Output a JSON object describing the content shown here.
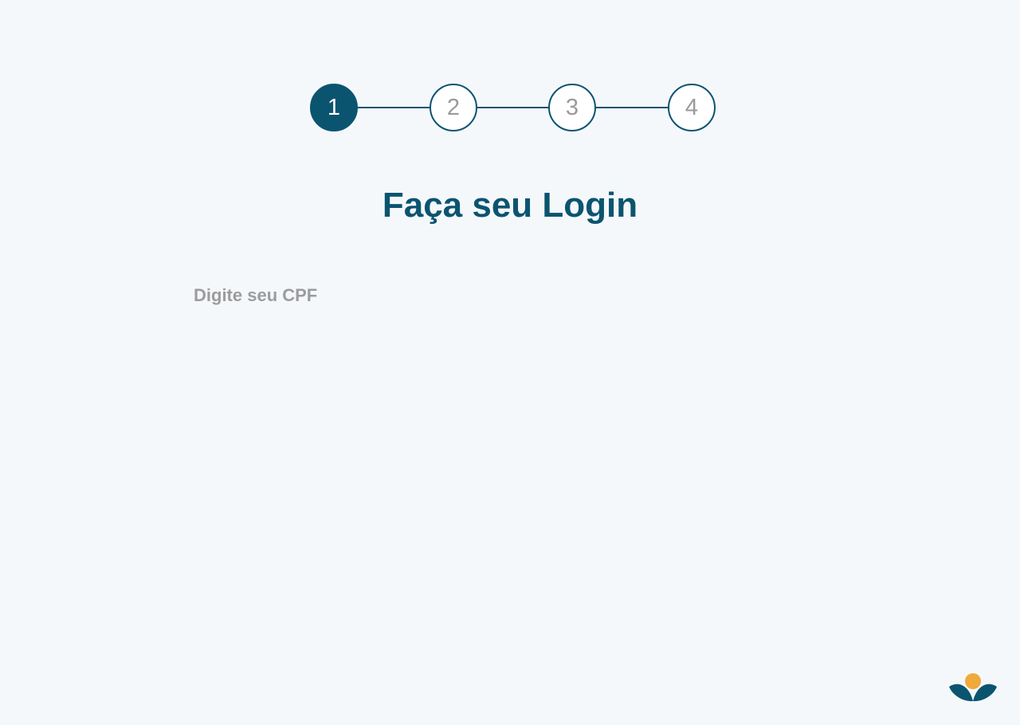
{
  "stepper": {
    "steps": [
      {
        "label": "1",
        "state": "active"
      },
      {
        "label": "2",
        "state": "inactive"
      },
      {
        "label": "3",
        "state": "inactive"
      },
      {
        "label": "4",
        "state": "inactive"
      }
    ]
  },
  "login": {
    "title": "Faça seu Login",
    "cpf_label": "Digite seu CPF",
    "cpf_value": ""
  },
  "brand": {
    "logo_icon": "sprout-sun-logo"
  },
  "colors": {
    "primary": "#0b5470",
    "accent": "#f0a93b",
    "background": "#f5f8fb",
    "muted_text": "#9c9c9c"
  }
}
